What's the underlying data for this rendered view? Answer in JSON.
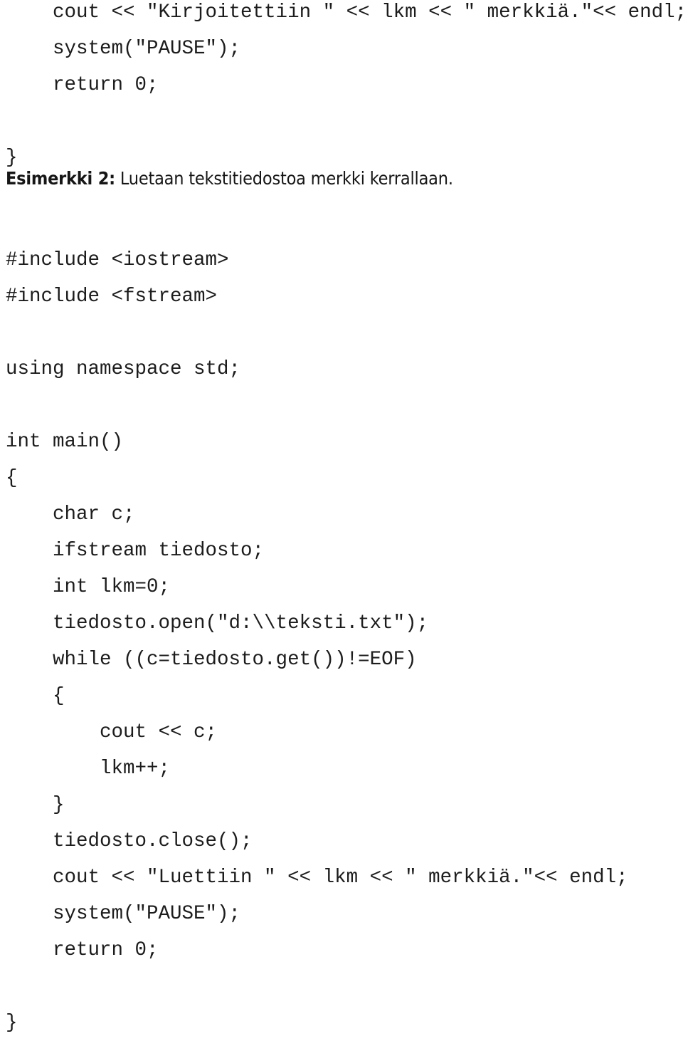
{
  "document": {
    "language": "fi",
    "background_color": "#ffffff",
    "text_color": "#1c1c1c"
  },
  "top_code": {
    "name": "previous-example-tail",
    "lines": [
      "    cout << \"Kirjoitettiin \" << lkm << \" merkkiä.\"<< endl;",
      "    system(\"PAUSE\");",
      "    return 0;",
      "",
      "}"
    ]
  },
  "heading": {
    "lead": "Esimerkki 2:",
    "rest": " Luetaan tekstitiedostoa merkki kerrallaan."
  },
  "main_code": {
    "name": "example-2-source",
    "lines": [
      "#include <iostream>",
      "#include <fstream>",
      "",
      "using namespace std;",
      "",
      "int main()",
      "{",
      "    char c;",
      "    ifstream tiedosto;",
      "    int lkm=0;",
      "    tiedosto.open(\"d:\\\\teksti.txt\");",
      "    while ((c=tiedosto.get())!=EOF)",
      "    {",
      "        cout << c;",
      "        lkm++;",
      "    }",
      "    tiedosto.close();",
      "    cout << \"Luettiin \" << lkm << \" merkkiä.\"<< endl;",
      "    system(\"PAUSE\");",
      "    return 0;",
      "",
      "}"
    ]
  }
}
